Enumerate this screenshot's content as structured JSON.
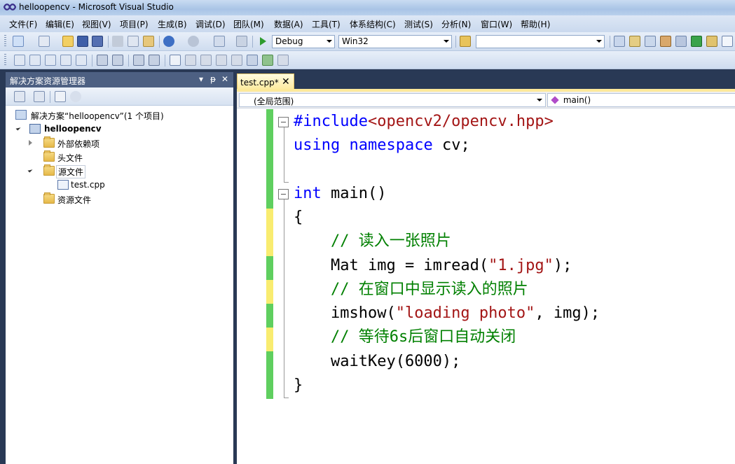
{
  "window": {
    "title": "helloopencv - Microsoft Visual Studio"
  },
  "menu": [
    "文件(F)",
    "编辑(E)",
    "视图(V)",
    "项目(P)",
    "生成(B)",
    "调试(D)",
    "团队(M)",
    "数据(A)",
    "工具(T)",
    "体系结构(C)",
    "测试(S)",
    "分析(N)",
    "窗口(W)",
    "帮助(H)"
  ],
  "toolbar": {
    "configuration": "Debug",
    "platform": "Win32",
    "find_value": ""
  },
  "solution_explorer": {
    "title": "解决方案资源管理器",
    "pin_glyph": "▾",
    "dock_glyph": "ᵽ",
    "close_glyph": "✕",
    "tree": {
      "solution": "解决方案“helloopencv”(1 个项目)",
      "project": "helloopencv",
      "external_deps": "外部依赖项",
      "header_files": "头文件",
      "source_files": "源文件",
      "test_cpp": "test.cpp",
      "resource_files": "资源文件"
    }
  },
  "editor": {
    "tab": {
      "label": "test.cpp*",
      "close": "✕"
    },
    "scope": "(全局范围)",
    "member": "main()",
    "code": {
      "l1_directive": "#include",
      "l1_header": "<opencv2/opencv.hpp>",
      "l2_kw1": "using",
      "l2_kw2": "namespace",
      "l2_rest": " cv;",
      "l4_kw": "int",
      "l4_rest": " main()",
      "l5": "{",
      "l6_comment": "    // 读入一张照片",
      "l7_pre": "    Mat img = imread(",
      "l7_str": "\"1.jpg\"",
      "l7_post": ");",
      "l8_comment": "    // 在窗口中显示读入的照片",
      "l9_pre": "    imshow(",
      "l9_str": "\"loading photo\"",
      "l9_post": ", img);",
      "l10_comment": "    // 等待6s后窗口自动关闭",
      "l11": "    waitKey(6000);",
      "l12": "}"
    },
    "colors": {
      "keyword": "#0000ff",
      "string": "#a31515",
      "comment": "#008000",
      "saved_change": "#5fcf5f",
      "unsaved_change": "#f9ec70"
    }
  }
}
